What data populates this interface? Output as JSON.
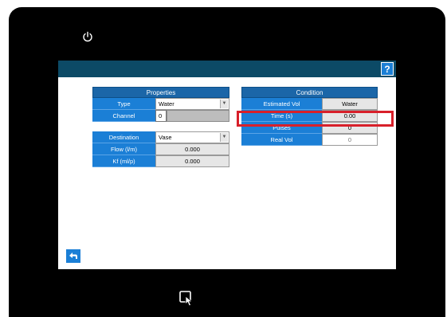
{
  "titlebar": {
    "help_label": "?"
  },
  "properties": {
    "header": "Properties",
    "type_label": "Type",
    "type_value": "Water",
    "channel_label": "Channel",
    "channel_value": "0"
  },
  "destination": {
    "destination_label": "Destination",
    "destination_value": "Vase",
    "flow_label": "Flow (l/m)",
    "flow_value": "0.000",
    "kf_label": "Kf (ml/p)",
    "kf_value": "0.000"
  },
  "condition": {
    "header": "Condition",
    "estimated_vol_label": "Estimated Vol",
    "estimated_vol_value": "Water",
    "time_label": "Time (s)",
    "time_value": "0.00",
    "pulses_label": "Pulses",
    "pulses_value": "0",
    "real_vol_label": "Real Vol",
    "real_vol_value": "0"
  },
  "icons": {
    "power": "power-icon",
    "back": "back-arrow-icon",
    "touch": "touch-icon",
    "dropdown": "chevron-down-icon"
  },
  "colors": {
    "title_bar": "#0c4a66",
    "accent": "#1b7fd6",
    "highlight": "#d8202a"
  }
}
